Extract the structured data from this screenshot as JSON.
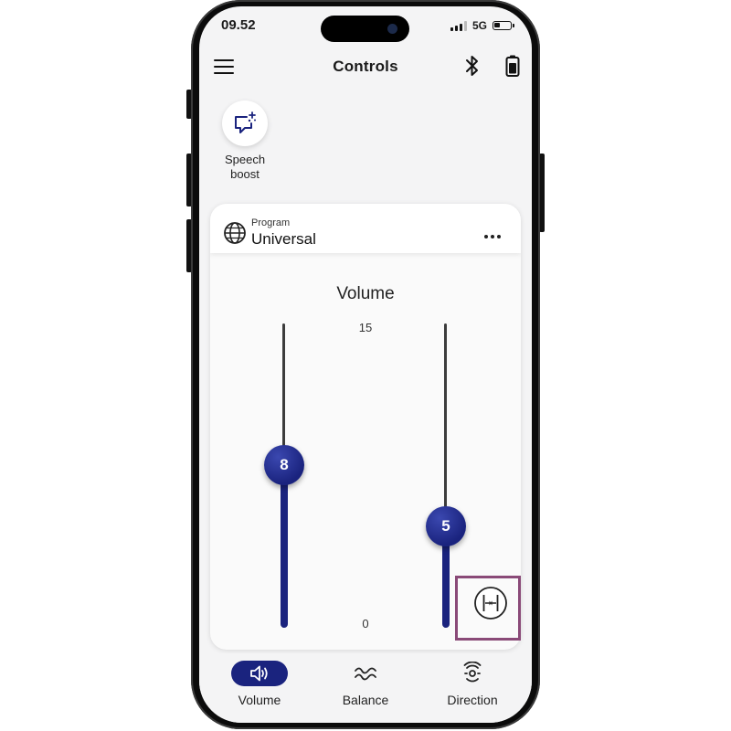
{
  "status_bar": {
    "time": "09.52",
    "network": "5G"
  },
  "header": {
    "title": "Controls"
  },
  "icons": {
    "menu": "hamburger-icon",
    "bluetooth": "bluetooth-icon",
    "device_battery": "device-battery-icon",
    "speech_boost": "speech-boost-icon",
    "program": "globe-icon",
    "more": "more-horizontal-icon",
    "split_sliders": "split-sliders-icon"
  },
  "speech_boost": {
    "label_line1": "Speech",
    "label_line2": "boost"
  },
  "program": {
    "caption": "Program",
    "name": "Universal"
  },
  "volume": {
    "title": "Volume",
    "scale_max": "15",
    "scale_min": "0",
    "left_value": "8",
    "right_value": "5",
    "max": 15
  },
  "bottom_nav": {
    "items": [
      {
        "label": "Volume",
        "active": true
      },
      {
        "label": "Balance",
        "active": false
      },
      {
        "label": "Direction",
        "active": false
      }
    ]
  },
  "colors": {
    "accent": "#1a237e",
    "highlight_box": "#8a4a78"
  }
}
